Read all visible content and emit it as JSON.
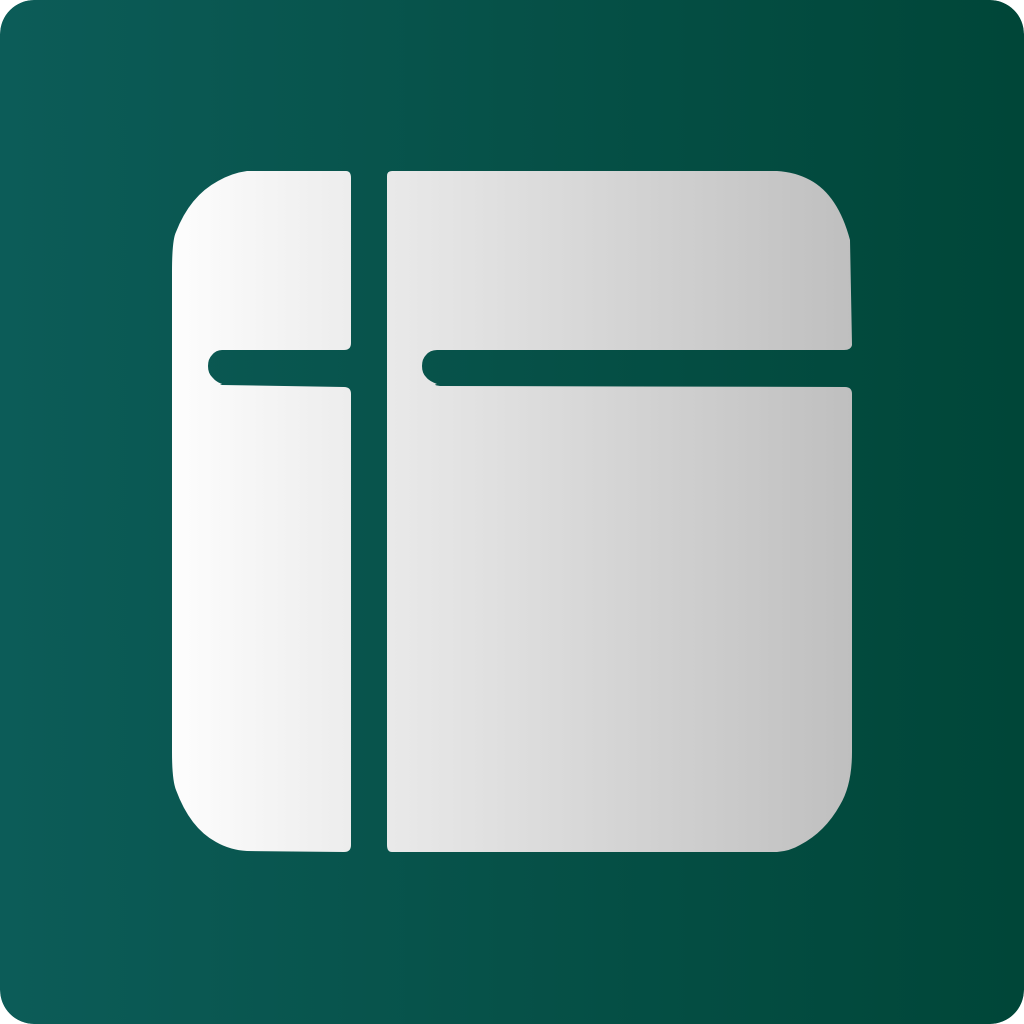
{
  "icon": {
    "name": "layout-sidebar-icon",
    "description_free": true,
    "colors": {
      "background_start": "#0c5c58",
      "background_end": "#004638",
      "glyph_light": "#fdfdfd",
      "glyph_dark": "#bfbfbf"
    }
  }
}
